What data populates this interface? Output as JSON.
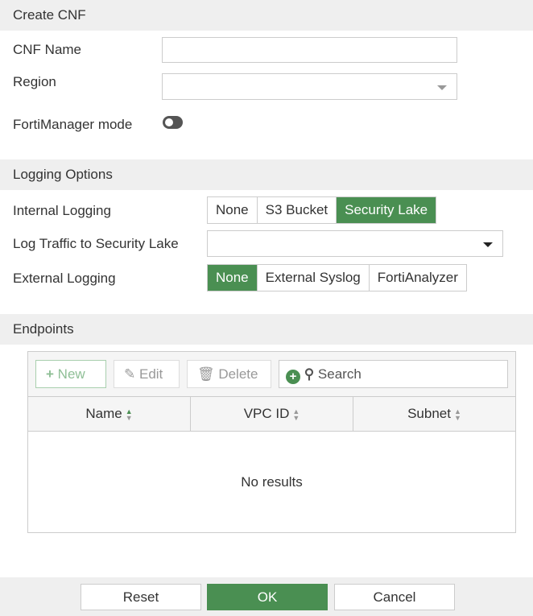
{
  "create": {
    "title": "Create CNF",
    "name_label": "CNF Name",
    "name_value": "",
    "region_label": "Region",
    "region_value": "",
    "fmg_label": "FortiManager mode",
    "fmg_enabled": false
  },
  "logging": {
    "title": "Logging Options",
    "internal_label": "Internal Logging",
    "internal_options": [
      "None",
      "S3 Bucket",
      "Security Lake"
    ],
    "internal_selected": "Security Lake",
    "traffic_label": "Log Traffic to Security Lake",
    "traffic_value": "",
    "external_label": "External Logging",
    "external_options": [
      "None",
      "External Syslog",
      "FortiAnalyzer"
    ],
    "external_selected": "None"
  },
  "endpoints": {
    "title": "Endpoints",
    "new": "New",
    "edit": "Edit",
    "delete": "Delete",
    "search_placeholder": "Search",
    "columns": [
      "Name",
      "VPC ID",
      "Subnet"
    ],
    "empty": "No results"
  },
  "footer": {
    "reset": "Reset",
    "ok": "OK",
    "cancel": "Cancel"
  },
  "colors": {
    "accent": "#4a8f52"
  }
}
